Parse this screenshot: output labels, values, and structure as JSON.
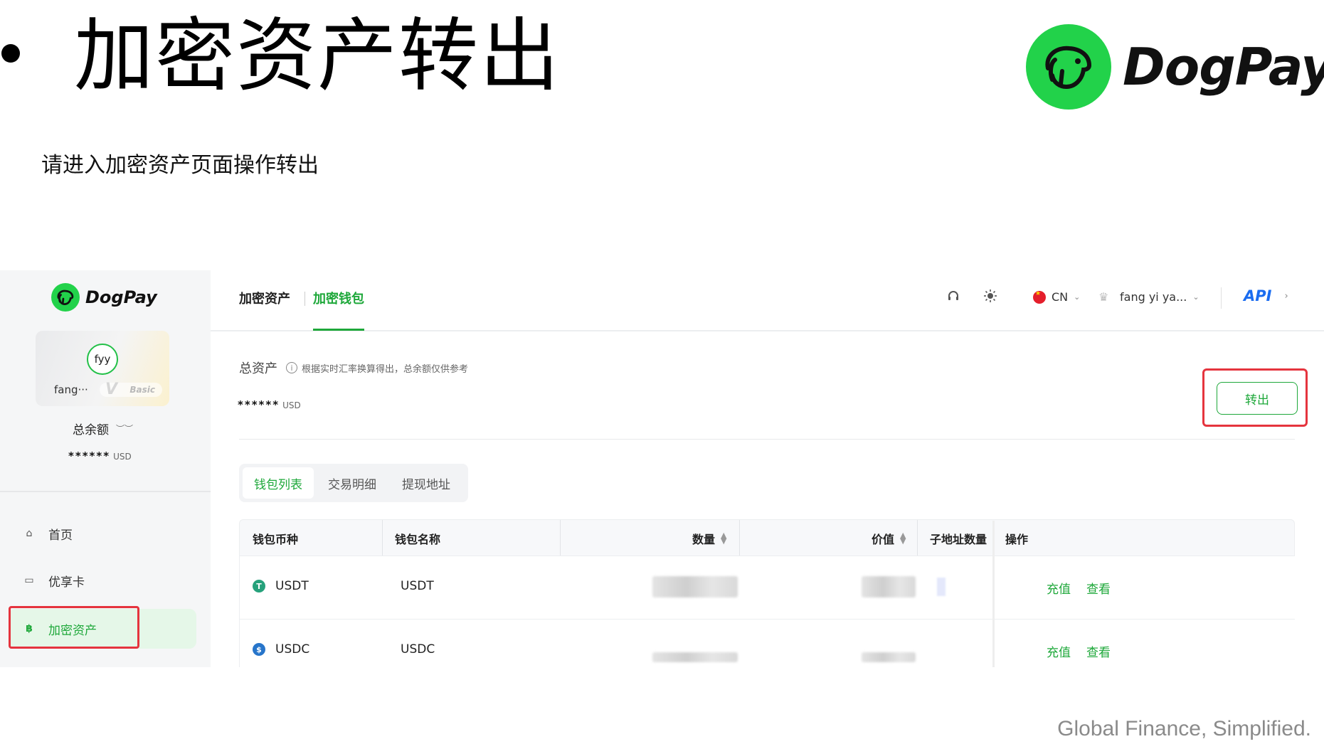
{
  "slide": {
    "title": "加密资产转出",
    "subtitle": "请进入加密资产页面操作转出",
    "brand": "DogPay",
    "tagline": "Global Finance, Simplified."
  },
  "sidebar": {
    "brand": "DogPay",
    "user": {
      "avatar_text": "fyy",
      "name": "fang···",
      "level": "Basic"
    },
    "balance_label": "总余额",
    "balance_value": "******",
    "balance_unit": "USD",
    "nav": [
      {
        "label": "首页",
        "icon": "home-icon",
        "active": false
      },
      {
        "label": "优享卡",
        "icon": "card-icon",
        "active": false
      },
      {
        "label": "加密资产",
        "icon": "bitcoin-icon",
        "active": true
      }
    ]
  },
  "topbar": {
    "breadcrumb_parent": "加密资产",
    "breadcrumb_current": "加密钱包",
    "language": "CN",
    "account_name": "fang yi ya...",
    "api_label": "API"
  },
  "assets": {
    "label": "总资产",
    "note": "根据实时汇率换算得出，总余额仅供参考",
    "value": "******",
    "unit": "USD",
    "transfer_button": "转出"
  },
  "tabs": [
    "钱包列表",
    "交易明细",
    "提现地址"
  ],
  "table": {
    "columns": [
      "钱包币种",
      "钱包名称",
      "数量",
      "价值",
      "子地址数量",
      "操作"
    ],
    "rows": [
      {
        "coin": "USDT",
        "wallet_name": "USDT",
        "coin_color": "#26a17b",
        "coin_glyph": "T",
        "actions": [
          "充值",
          "查看"
        ]
      },
      {
        "coin": "USDC",
        "wallet_name": "USDC",
        "coin_color": "#2775ca",
        "coin_glyph": "$",
        "actions": [
          "充值",
          "查看"
        ]
      }
    ]
  },
  "colors": {
    "accent": "#1ea83a",
    "brand_green": "#22d24a",
    "highlight": "#e5343e",
    "api_blue": "#1a6cf0"
  }
}
